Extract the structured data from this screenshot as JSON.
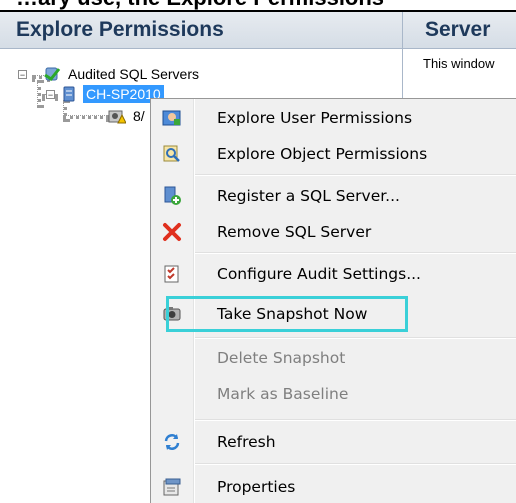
{
  "top_cut_text": "…ary use, the Explore Permissions",
  "left_panel": {
    "title": "Explore Permissions"
  },
  "right_panel": {
    "title": "Server",
    "body": "This window"
  },
  "tree": {
    "root": {
      "label": "Audited SQL Servers",
      "icon": "server-group-icon"
    },
    "server": {
      "label": "CH-SP2010",
      "icon": "database-server-icon",
      "selected": true
    },
    "snapshot": {
      "label": "8/",
      "icon": "snapshot-warning-icon"
    }
  },
  "context_menu": {
    "items": [
      {
        "label": "Explore User Permissions",
        "icon": "user-permissions-icon",
        "enabled": true
      },
      {
        "label": "Explore Object Permissions",
        "icon": "object-permissions-icon",
        "enabled": true
      },
      {
        "label": "Register a SQL Server...",
        "icon": "register-server-icon",
        "enabled": true
      },
      {
        "label": "Remove SQL Server",
        "icon": "remove-x-icon",
        "enabled": true
      },
      {
        "label": "Configure Audit Settings...",
        "icon": "audit-settings-icon",
        "enabled": true
      },
      {
        "label": "Take Snapshot Now",
        "icon": "camera-icon",
        "enabled": true,
        "highlighted": true
      },
      {
        "label": "Delete Snapshot",
        "icon": "",
        "enabled": false
      },
      {
        "label": "Mark as Baseline",
        "icon": "",
        "enabled": false
      },
      {
        "label": "Refresh",
        "icon": "refresh-icon",
        "enabled": true
      },
      {
        "label": "Properties",
        "icon": "properties-icon",
        "enabled": true
      }
    ]
  },
  "colors": {
    "highlight": "#3ad0d8",
    "selection": "#3399ff",
    "header_text": "#1e395b"
  }
}
